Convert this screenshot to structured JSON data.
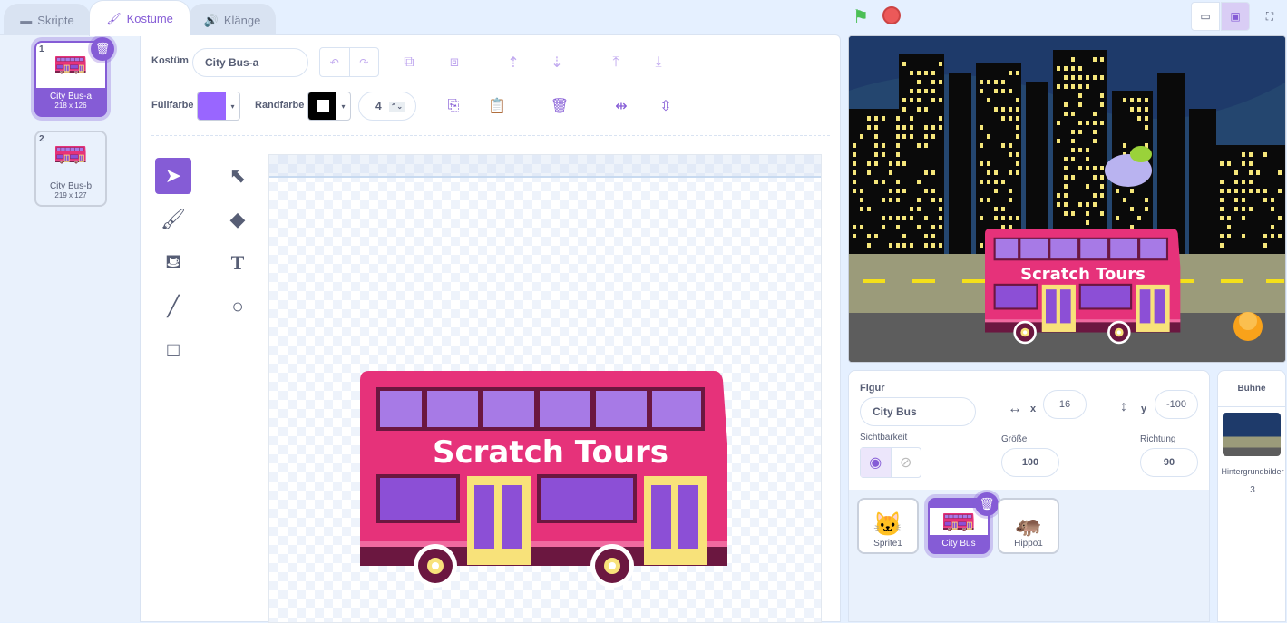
{
  "tabs": [
    {
      "label": "Skripte",
      "icon": "code-icon"
    },
    {
      "label": "Kostüme",
      "icon": "brush-icon"
    },
    {
      "label": "Klänge",
      "icon": "speaker-icon"
    }
  ],
  "costumes": [
    {
      "num": "1",
      "name": "City Bus-a",
      "size": "218 x 126"
    },
    {
      "num": "2",
      "name": "City Bus-b",
      "size": "219 x 127"
    }
  ],
  "editor": {
    "costume_label": "Kostüm",
    "costume_name": "City Bus-a",
    "fill_label": "Füllfarbe",
    "fill_color": "#9966ff",
    "outline_label": "Randfarbe",
    "outline_color": "#000000",
    "outline_width": "4",
    "bus_text": "Scratch Tours"
  },
  "sprite": {
    "label": "Figur",
    "name": "City Bus",
    "x_label": "x",
    "x": "16",
    "y_label": "y",
    "y": "-100",
    "visibility_label": "Sichtbarkeit",
    "size_label": "Größe",
    "size": "100",
    "direction_label": "Richtung",
    "direction": "90"
  },
  "sprites": [
    {
      "name": "Sprite1"
    },
    {
      "name": "City Bus"
    },
    {
      "name": "Hippo1"
    }
  ],
  "stage_pane": {
    "title": "Bühne",
    "backdrops_label": "Hintergrundbilder",
    "backdrops_count": "3"
  },
  "colors": {
    "accent": "#855cd6",
    "bus": "#e6327a"
  }
}
